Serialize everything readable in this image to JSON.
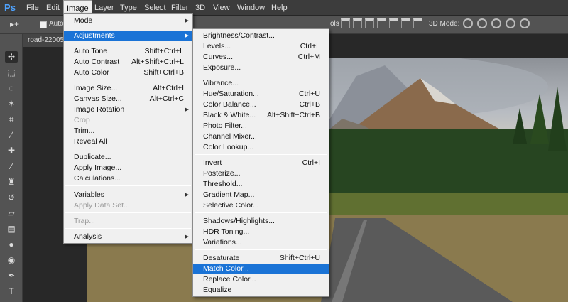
{
  "app": {
    "logo": "Ps",
    "menubar": [
      "File",
      "Edit",
      "Image",
      "Layer",
      "Type",
      "Select",
      "Filter",
      "3D",
      "View",
      "Window",
      "Help"
    ],
    "active_menu": "Image"
  },
  "options_bar": {
    "auto_select_label": "Auto-",
    "partial_label": "ols",
    "mode_3d_label": "3D Mode:"
  },
  "document": {
    "tab_label": "road-22005"
  },
  "image_menu": {
    "items": [
      {
        "label": "Mode",
        "shortcut": "",
        "submenu": true,
        "disabled": false
      },
      {
        "label": "Adjustments",
        "shortcut": "",
        "submenu": true,
        "disabled": false,
        "highlighted": true
      },
      {
        "label": "Auto Tone",
        "shortcut": "Shift+Ctrl+L",
        "disabled": false
      },
      {
        "label": "Auto Contrast",
        "shortcut": "Alt+Shift+Ctrl+L",
        "disabled": false
      },
      {
        "label": "Auto Color",
        "shortcut": "Shift+Ctrl+B",
        "disabled": false
      },
      {
        "label": "Image Size...",
        "shortcut": "Alt+Ctrl+I",
        "disabled": false
      },
      {
        "label": "Canvas Size...",
        "shortcut": "Alt+Ctrl+C",
        "disabled": false
      },
      {
        "label": "Image Rotation",
        "shortcut": "",
        "submenu": true,
        "disabled": false
      },
      {
        "label": "Crop",
        "shortcut": "",
        "disabled": true
      },
      {
        "label": "Trim...",
        "shortcut": "",
        "disabled": false
      },
      {
        "label": "Reveal All",
        "shortcut": "",
        "disabled": false
      },
      {
        "label": "Duplicate...",
        "shortcut": "",
        "disabled": false
      },
      {
        "label": "Apply Image...",
        "shortcut": "",
        "disabled": false
      },
      {
        "label": "Calculations...",
        "shortcut": "",
        "disabled": false
      },
      {
        "label": "Variables",
        "shortcut": "",
        "submenu": true,
        "disabled": false
      },
      {
        "label": "Apply Data Set...",
        "shortcut": "",
        "disabled": true
      },
      {
        "label": "Trap...",
        "shortcut": "",
        "disabled": true
      },
      {
        "label": "Analysis",
        "shortcut": "",
        "submenu": true,
        "disabled": false
      }
    ]
  },
  "adjustments_menu": {
    "items": [
      {
        "label": "Brightness/Contrast...",
        "shortcut": ""
      },
      {
        "label": "Levels...",
        "shortcut": "Ctrl+L"
      },
      {
        "label": "Curves...",
        "shortcut": "Ctrl+M"
      },
      {
        "label": "Exposure...",
        "shortcut": ""
      },
      {
        "label": "Vibrance...",
        "shortcut": ""
      },
      {
        "label": "Hue/Saturation...",
        "shortcut": "Ctrl+U"
      },
      {
        "label": "Color Balance...",
        "shortcut": "Ctrl+B"
      },
      {
        "label": "Black & White...",
        "shortcut": "Alt+Shift+Ctrl+B"
      },
      {
        "label": "Photo Filter...",
        "shortcut": ""
      },
      {
        "label": "Channel Mixer...",
        "shortcut": ""
      },
      {
        "label": "Color Lookup...",
        "shortcut": ""
      },
      {
        "label": "Invert",
        "shortcut": "Ctrl+I"
      },
      {
        "label": "Posterize...",
        "shortcut": ""
      },
      {
        "label": "Threshold...",
        "shortcut": ""
      },
      {
        "label": "Gradient Map...",
        "shortcut": ""
      },
      {
        "label": "Selective Color...",
        "shortcut": ""
      },
      {
        "label": "Shadows/Highlights...",
        "shortcut": ""
      },
      {
        "label": "HDR Toning...",
        "shortcut": ""
      },
      {
        "label": "Variations...",
        "shortcut": ""
      },
      {
        "label": "Desaturate",
        "shortcut": "Shift+Ctrl+U"
      },
      {
        "label": "Match Color...",
        "shortcut": "",
        "highlighted": true
      },
      {
        "label": "Replace Color...",
        "shortcut": ""
      },
      {
        "label": "Equalize",
        "shortcut": ""
      }
    ]
  },
  "colors": {
    "highlight": "#1a73d6",
    "menu_bg": "#f0f0f0",
    "ui_dark": "#535353",
    "logo": "#4fa3ff"
  }
}
